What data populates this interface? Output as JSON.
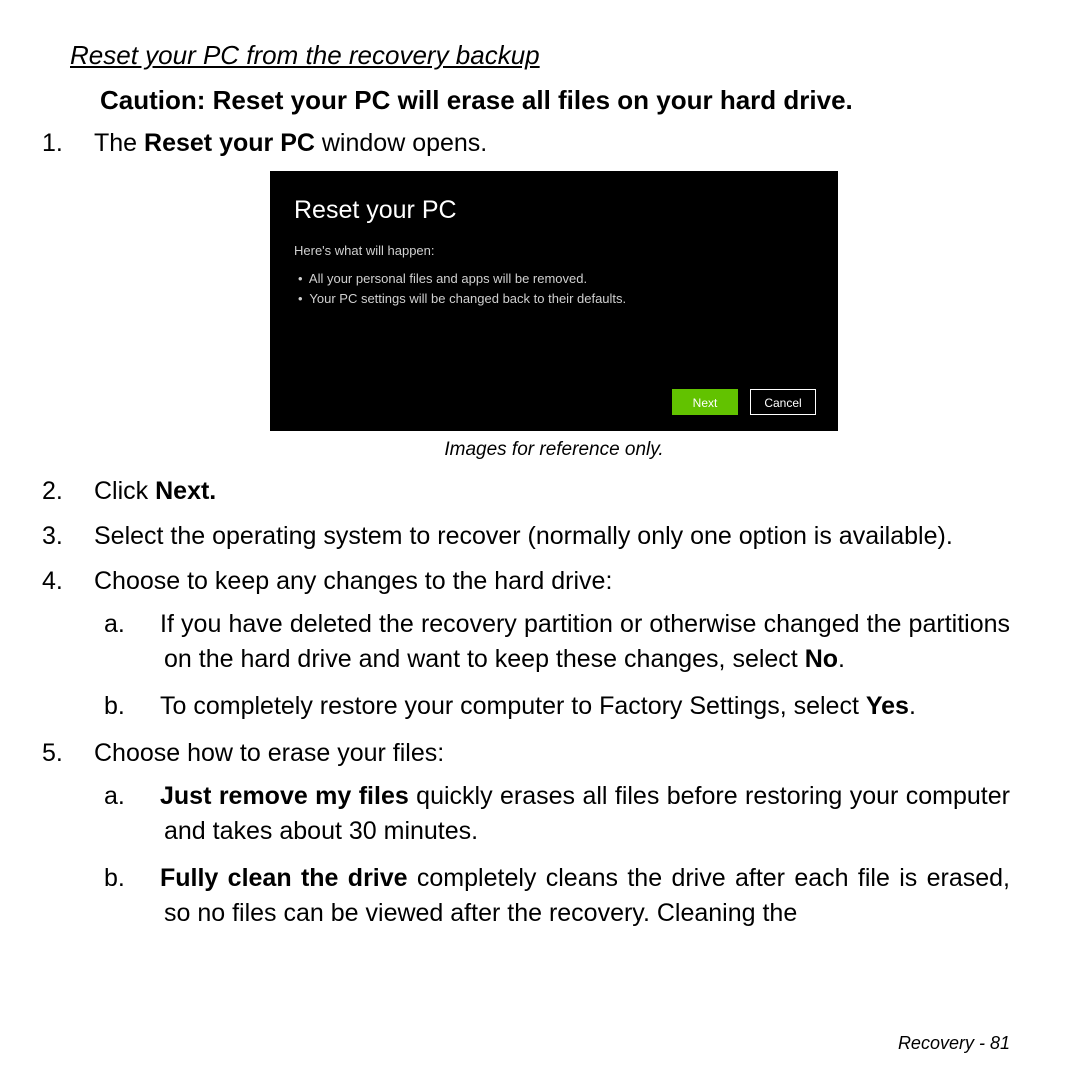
{
  "section_title": "Reset your PC from the recovery backup",
  "caution": "Caution: Reset your PC will erase all files on your hard drive.",
  "step1_pre": "The ",
  "step1_bold": "Reset your PC",
  "step1_post": " window opens.",
  "screenshot": {
    "title": "Reset your PC",
    "subtitle": "Here's what will happen:",
    "bullets": [
      "All your personal files and apps will be removed.",
      "Your PC settings will be changed back to their defaults."
    ],
    "next_label": "Next",
    "cancel_label": "Cancel"
  },
  "img_caption": "Images for reference only.",
  "step2_pre": "Click ",
  "step2_bold": "Next.",
  "step3": "Select the operating system to recover (normally only one option is available).",
  "step4": "Choose to keep any changes to the hard drive:",
  "step4a_pre": "If you have deleted the recovery partition or otherwise changed the partitions on the hard drive and want to keep these changes, select ",
  "step4a_bold": "No",
  "step4a_post": ".",
  "step4b_pre": "To completely restore your computer to Factory Settings, select ",
  "step4b_bold": "Yes",
  "step4b_post": ".",
  "step5": "Choose how to erase your files:",
  "step5a_bold": "Just remove my files",
  "step5a_rest": " quickly erases all files before restoring your computer and takes about 30 minutes.",
  "step5b_bold": "Fully clean the drive",
  "step5b_rest": " completely cleans the drive after each file is erased, so no files can be viewed after the recovery. Cleaning the",
  "footer_section": "Recovery -  ",
  "footer_page": "81"
}
